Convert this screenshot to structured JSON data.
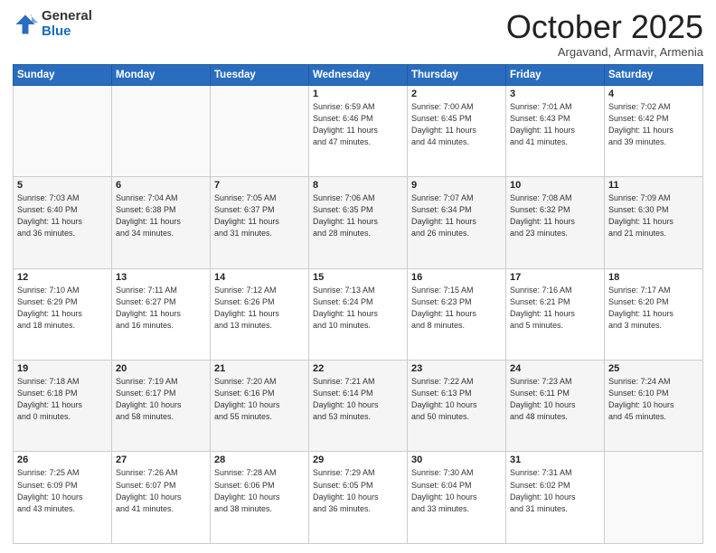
{
  "logo": {
    "general": "General",
    "blue": "Blue"
  },
  "header": {
    "month": "October 2025",
    "location": "Argavand, Armavir, Armenia"
  },
  "weekdays": [
    "Sunday",
    "Monday",
    "Tuesday",
    "Wednesday",
    "Thursday",
    "Friday",
    "Saturday"
  ],
  "weeks": [
    [
      {
        "day": "",
        "info": ""
      },
      {
        "day": "",
        "info": ""
      },
      {
        "day": "",
        "info": ""
      },
      {
        "day": "1",
        "info": "Sunrise: 6:59 AM\nSunset: 6:46 PM\nDaylight: 11 hours\nand 47 minutes."
      },
      {
        "day": "2",
        "info": "Sunrise: 7:00 AM\nSunset: 6:45 PM\nDaylight: 11 hours\nand 44 minutes."
      },
      {
        "day": "3",
        "info": "Sunrise: 7:01 AM\nSunset: 6:43 PM\nDaylight: 11 hours\nand 41 minutes."
      },
      {
        "day": "4",
        "info": "Sunrise: 7:02 AM\nSunset: 6:42 PM\nDaylight: 11 hours\nand 39 minutes."
      }
    ],
    [
      {
        "day": "5",
        "info": "Sunrise: 7:03 AM\nSunset: 6:40 PM\nDaylight: 11 hours\nand 36 minutes."
      },
      {
        "day": "6",
        "info": "Sunrise: 7:04 AM\nSunset: 6:38 PM\nDaylight: 11 hours\nand 34 minutes."
      },
      {
        "day": "7",
        "info": "Sunrise: 7:05 AM\nSunset: 6:37 PM\nDaylight: 11 hours\nand 31 minutes."
      },
      {
        "day": "8",
        "info": "Sunrise: 7:06 AM\nSunset: 6:35 PM\nDaylight: 11 hours\nand 28 minutes."
      },
      {
        "day": "9",
        "info": "Sunrise: 7:07 AM\nSunset: 6:34 PM\nDaylight: 11 hours\nand 26 minutes."
      },
      {
        "day": "10",
        "info": "Sunrise: 7:08 AM\nSunset: 6:32 PM\nDaylight: 11 hours\nand 23 minutes."
      },
      {
        "day": "11",
        "info": "Sunrise: 7:09 AM\nSunset: 6:30 PM\nDaylight: 11 hours\nand 21 minutes."
      }
    ],
    [
      {
        "day": "12",
        "info": "Sunrise: 7:10 AM\nSunset: 6:29 PM\nDaylight: 11 hours\nand 18 minutes."
      },
      {
        "day": "13",
        "info": "Sunrise: 7:11 AM\nSunset: 6:27 PM\nDaylight: 11 hours\nand 16 minutes."
      },
      {
        "day": "14",
        "info": "Sunrise: 7:12 AM\nSunset: 6:26 PM\nDaylight: 11 hours\nand 13 minutes."
      },
      {
        "day": "15",
        "info": "Sunrise: 7:13 AM\nSunset: 6:24 PM\nDaylight: 11 hours\nand 10 minutes."
      },
      {
        "day": "16",
        "info": "Sunrise: 7:15 AM\nSunset: 6:23 PM\nDaylight: 11 hours\nand 8 minutes."
      },
      {
        "day": "17",
        "info": "Sunrise: 7:16 AM\nSunset: 6:21 PM\nDaylight: 11 hours\nand 5 minutes."
      },
      {
        "day": "18",
        "info": "Sunrise: 7:17 AM\nSunset: 6:20 PM\nDaylight: 11 hours\nand 3 minutes."
      }
    ],
    [
      {
        "day": "19",
        "info": "Sunrise: 7:18 AM\nSunset: 6:18 PM\nDaylight: 11 hours\nand 0 minutes."
      },
      {
        "day": "20",
        "info": "Sunrise: 7:19 AM\nSunset: 6:17 PM\nDaylight: 10 hours\nand 58 minutes."
      },
      {
        "day": "21",
        "info": "Sunrise: 7:20 AM\nSunset: 6:16 PM\nDaylight: 10 hours\nand 55 minutes."
      },
      {
        "day": "22",
        "info": "Sunrise: 7:21 AM\nSunset: 6:14 PM\nDaylight: 10 hours\nand 53 minutes."
      },
      {
        "day": "23",
        "info": "Sunrise: 7:22 AM\nSunset: 6:13 PM\nDaylight: 10 hours\nand 50 minutes."
      },
      {
        "day": "24",
        "info": "Sunrise: 7:23 AM\nSunset: 6:11 PM\nDaylight: 10 hours\nand 48 minutes."
      },
      {
        "day": "25",
        "info": "Sunrise: 7:24 AM\nSunset: 6:10 PM\nDaylight: 10 hours\nand 45 minutes."
      }
    ],
    [
      {
        "day": "26",
        "info": "Sunrise: 7:25 AM\nSunset: 6:09 PM\nDaylight: 10 hours\nand 43 minutes."
      },
      {
        "day": "27",
        "info": "Sunrise: 7:26 AM\nSunset: 6:07 PM\nDaylight: 10 hours\nand 41 minutes."
      },
      {
        "day": "28",
        "info": "Sunrise: 7:28 AM\nSunset: 6:06 PM\nDaylight: 10 hours\nand 38 minutes."
      },
      {
        "day": "29",
        "info": "Sunrise: 7:29 AM\nSunset: 6:05 PM\nDaylight: 10 hours\nand 36 minutes."
      },
      {
        "day": "30",
        "info": "Sunrise: 7:30 AM\nSunset: 6:04 PM\nDaylight: 10 hours\nand 33 minutes."
      },
      {
        "day": "31",
        "info": "Sunrise: 7:31 AM\nSunset: 6:02 PM\nDaylight: 10 hours\nand 31 minutes."
      },
      {
        "day": "",
        "info": ""
      }
    ]
  ]
}
